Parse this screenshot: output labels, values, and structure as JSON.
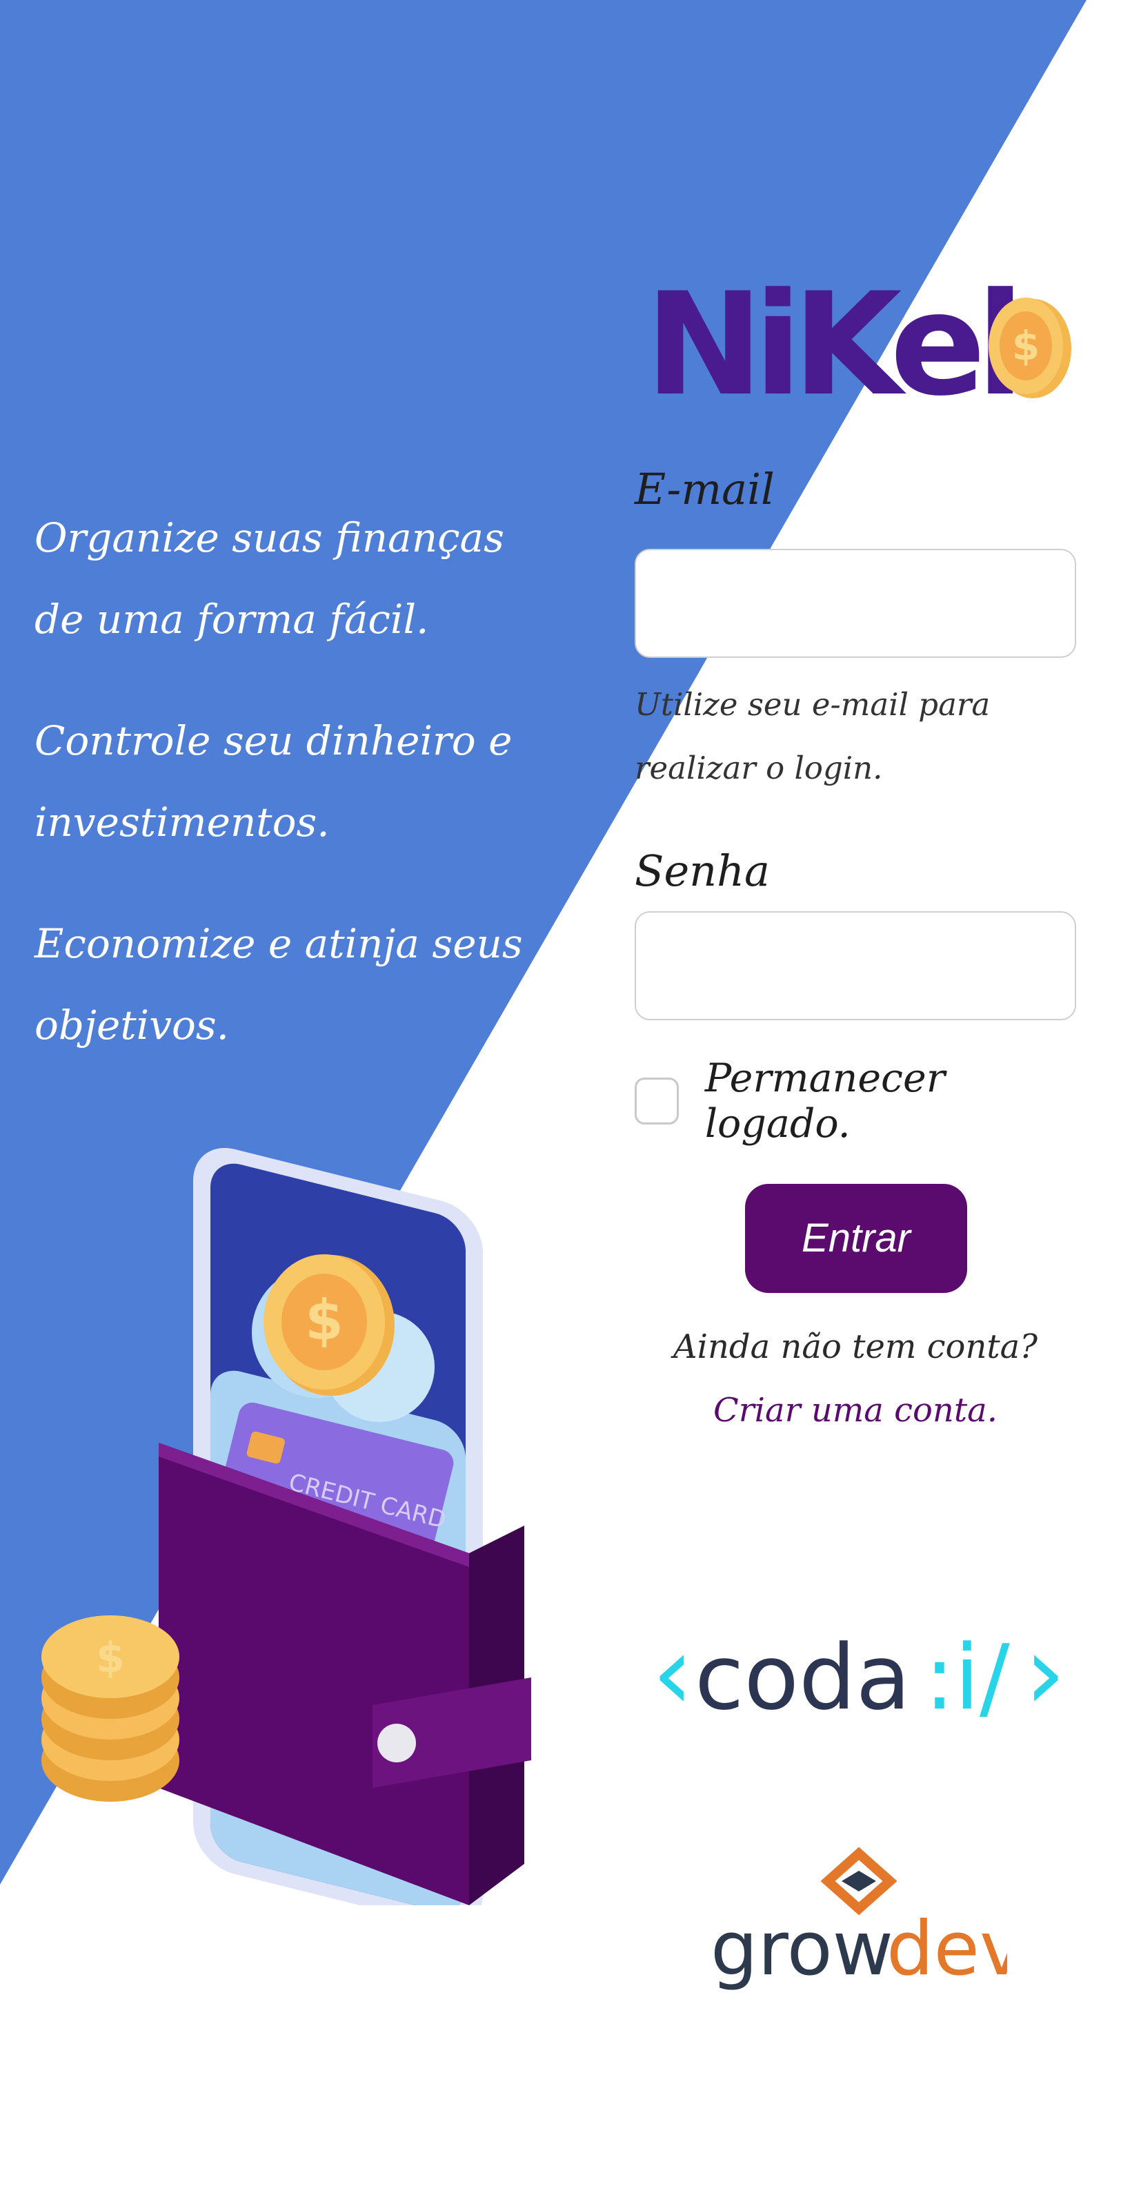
{
  "brand": {
    "name": "NiKel",
    "primary_color": "#5b0b6e",
    "background_blue": "#4f7ed6",
    "coin_icon": "dollar-coin-icon"
  },
  "slogans": [
    "Organize suas finanças de uma forma fácil.",
    "Controle seu dinheiro e investimentos.",
    "Economize e atinja seus objetivos."
  ],
  "form": {
    "email_label": "E-mail",
    "email_value": "",
    "email_hint": "Utilize seu e-mail para realizar o login.",
    "password_label": "Senha",
    "password_value": "",
    "remember_label": "Permanecer logado.",
    "remember_checked": false,
    "login_button": "Entrar",
    "signup_prompt": "Ainda não tem conta?",
    "signup_link": "Criar uma conta."
  },
  "illustration": {
    "card_text": "CREDIT CARD"
  },
  "partners": {
    "coda": {
      "lt": "‹",
      "name": "coda",
      "slash": ":i/",
      "gt": "›"
    },
    "growdev": {
      "left": "grow",
      "right": "dev"
    }
  }
}
